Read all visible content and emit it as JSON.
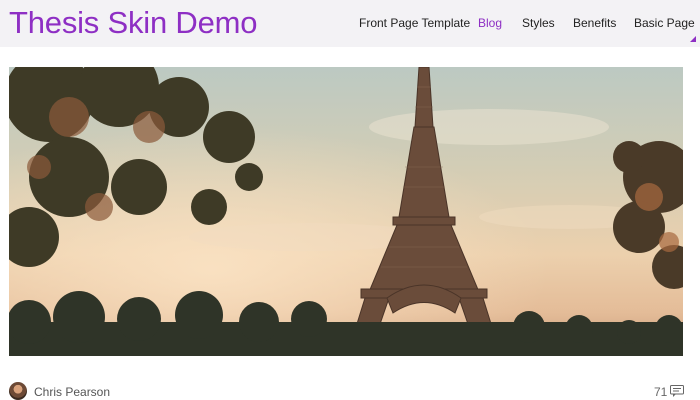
{
  "header": {
    "site_title": "Thesis Skin Demo",
    "nav": {
      "items": [
        {
          "label": "Front Page Template"
        },
        {
          "label": "Blog"
        },
        {
          "label": "Styles"
        },
        {
          "label": "Benefits"
        },
        {
          "label": "Basic Page"
        }
      ],
      "active_index": 1
    }
  },
  "post": {
    "featured_image": "eiffel-tower-photo",
    "author": "Chris Pearson",
    "comment_count": "71",
    "comment_icon": "comment-icon"
  },
  "colors": {
    "accent": "#8e2fc4",
    "header_bg": "#f3f2f5",
    "nav_text": "#222222",
    "meta_text": "#555555"
  }
}
